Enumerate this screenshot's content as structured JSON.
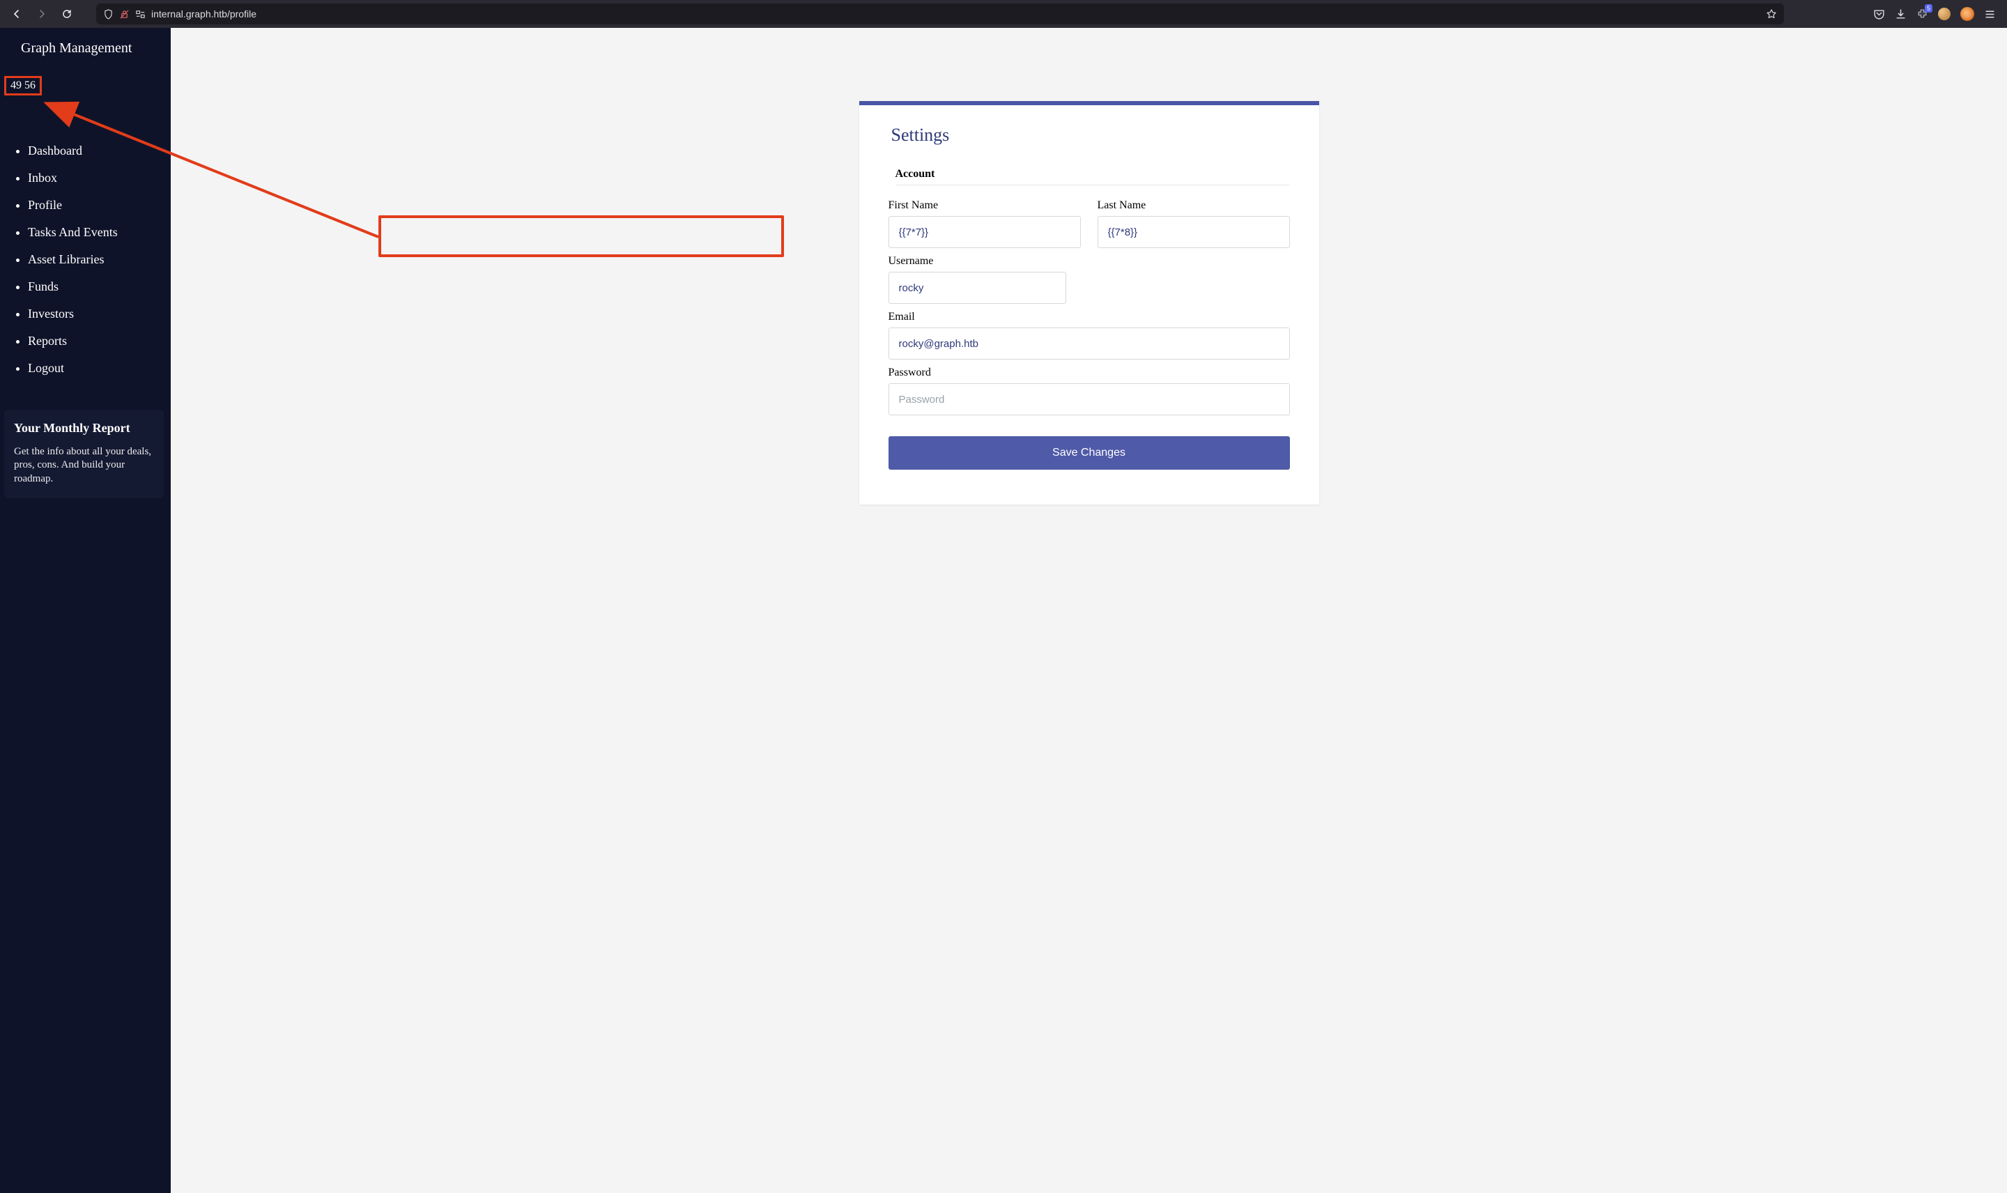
{
  "browser": {
    "url": "internal.graph.htb/profile",
    "ext_badge": "5"
  },
  "sidebar": {
    "brand": "Graph Management",
    "result_text": "49 56",
    "items": [
      "Dashboard",
      "Inbox",
      "Profile",
      "Tasks And Events",
      "Asset Libraries",
      "Funds",
      "Investors",
      "Reports",
      "Logout"
    ],
    "promo": {
      "title": "Your Monthly Report",
      "body": "Get the info about all your deals, pros, cons. And build your roadmap."
    }
  },
  "settings": {
    "heading": "Settings",
    "section": "Account",
    "labels": {
      "first_name": "First Name",
      "last_name": "Last Name",
      "username": "Username",
      "email": "Email",
      "password": "Password"
    },
    "values": {
      "first_name": "{{7*7}}",
      "last_name": "{{7*8}}",
      "username": "rocky",
      "email": "rocky@graph.htb",
      "password": ""
    },
    "placeholders": {
      "password": "Password"
    },
    "save_label": "Save Changes"
  }
}
